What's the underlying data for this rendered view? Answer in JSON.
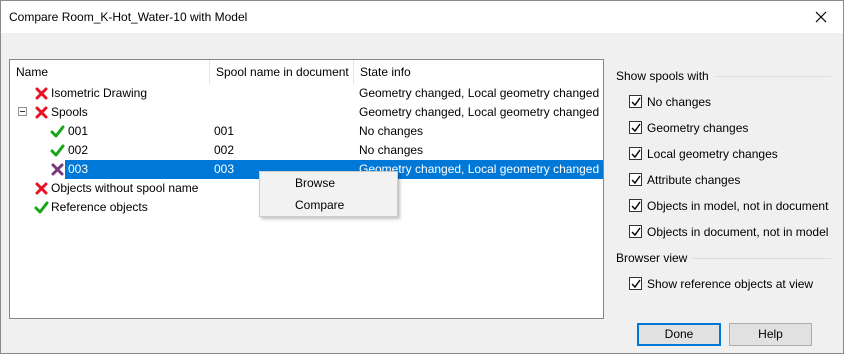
{
  "window": {
    "title": "Compare Room_K-Hot_Water-10 with Model"
  },
  "tree": {
    "columns": [
      "Name",
      "Spool name in document",
      "State info"
    ],
    "rows": [
      {
        "name": "Isometric Drawing",
        "spool": "",
        "state": "Geometry changed, Local geometry changed",
        "icon": "red-x-icon"
      },
      {
        "name": "Spools",
        "spool": "",
        "state": "Geometry changed, Local geometry changed",
        "icon": "red-x-icon"
      },
      {
        "name": "001",
        "spool": "001",
        "state": "No changes",
        "icon": "green-check-icon"
      },
      {
        "name": "002",
        "spool": "002",
        "state": "No changes",
        "icon": "green-check-icon"
      },
      {
        "name": "003",
        "spool": "003",
        "state": "Geometry changed, Local geometry changed",
        "icon": "red-x-icon"
      },
      {
        "name": "Objects without spool name",
        "spool": "",
        "state": "",
        "icon": "red-x-icon"
      },
      {
        "name": "Reference objects",
        "spool": "",
        "state": "",
        "icon": "green-check-icon"
      }
    ]
  },
  "context_menu": {
    "items": [
      "Browse",
      "Compare"
    ]
  },
  "show_spools": {
    "title": "Show spools with",
    "options": [
      {
        "label": "No changes",
        "checked": true
      },
      {
        "label": "Geometry changes",
        "checked": true
      },
      {
        "label": "Local geometry changes",
        "checked": true
      },
      {
        "label": "Attribute changes",
        "checked": true
      },
      {
        "label": "Objects in model, not in document",
        "checked": true
      },
      {
        "label": "Objects in document, not in model",
        "checked": true
      }
    ]
  },
  "browser_view": {
    "title": "Browser view",
    "options": [
      {
        "label": "Show reference objects at view",
        "checked": true
      }
    ]
  },
  "buttons": {
    "done": "Done",
    "help": "Help"
  },
  "colors": {
    "selection": "#0078d7",
    "error_red": "#e81123",
    "ok_green": "#16a616"
  }
}
